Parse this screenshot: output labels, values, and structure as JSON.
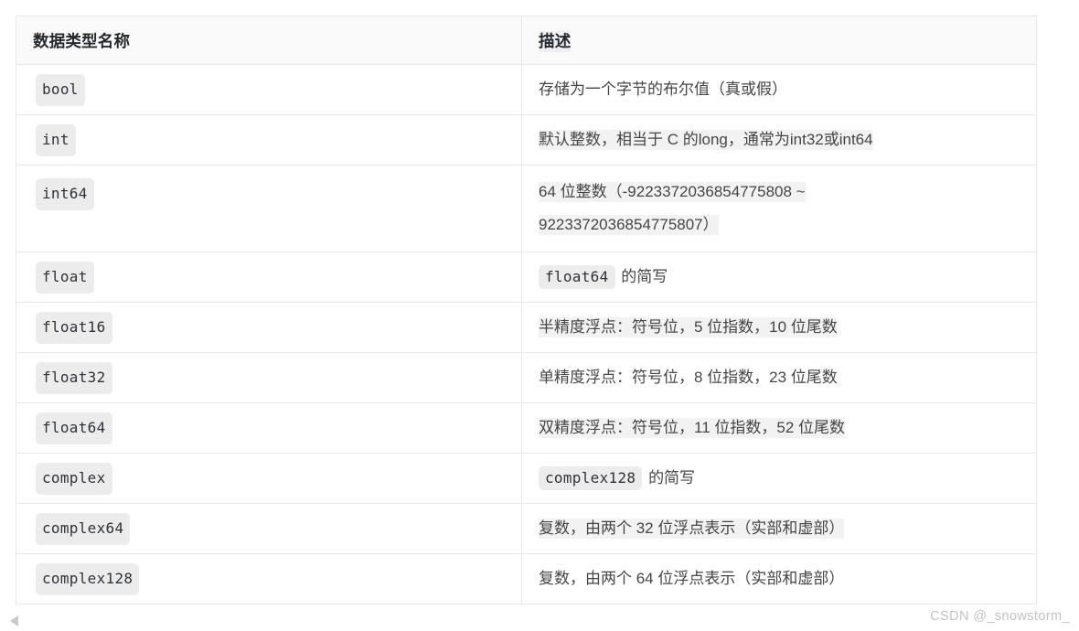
{
  "table": {
    "headers": {
      "name": "数据类型名称",
      "description": "描述"
    },
    "rows": [
      {
        "name": "bool",
        "desc_lines": [
          "存储为一个字节的布尔值（真或假）"
        ],
        "desc_prefix_code": "",
        "highlighted": false,
        "tall": false
      },
      {
        "name": "int",
        "desc_lines": [
          "默认整数，相当于 C 的long，通常为int32或int64"
        ],
        "desc_prefix_code": "",
        "highlighted": true,
        "tall": false
      },
      {
        "name": "int64",
        "desc_lines": [
          "64 位整数（-9223372036854775808 ~",
          "9223372036854775807）"
        ],
        "desc_prefix_code": "",
        "highlighted": true,
        "tall": true
      },
      {
        "name": "float",
        "desc_lines": [
          "的简写"
        ],
        "desc_prefix_code": "float64",
        "highlighted": false,
        "tall": false
      },
      {
        "name": "float16",
        "desc_lines": [
          "半精度浮点：符号位，5 位指数，10 位尾数"
        ],
        "desc_prefix_code": "",
        "highlighted": true,
        "tall": false
      },
      {
        "name": "float32",
        "desc_lines": [
          "单精度浮点：符号位，8 位指数，23 位尾数"
        ],
        "desc_prefix_code": "",
        "highlighted": false,
        "tall": false
      },
      {
        "name": "float64",
        "desc_lines": [
          "双精度浮点：符号位，11 位指数，52 位尾数"
        ],
        "desc_prefix_code": "",
        "highlighted": true,
        "tall": false
      },
      {
        "name": "complex",
        "desc_lines": [
          "的简写"
        ],
        "desc_prefix_code": "complex128",
        "highlighted": false,
        "tall": false
      },
      {
        "name": "complex64",
        "desc_lines": [
          "复数，由两个 32 位浮点表示（实部和虚部）"
        ],
        "desc_prefix_code": "",
        "highlighted": true,
        "tall": false
      },
      {
        "name": "complex128",
        "desc_lines": [
          "复数，由两个 64 位浮点表示（实部和虚部）"
        ],
        "desc_prefix_code": "",
        "highlighted": false,
        "tall": false
      }
    ]
  },
  "scrollbar": {
    "left_arrow_glyph": "◀"
  },
  "watermark": {
    "text": "CSDN @_snowstorm_"
  },
  "colors": {
    "header_bg": "#fafafa",
    "border": "#e8e8e8",
    "code_chip_bg": "#ececec",
    "selection_bg": "#f2f2f2",
    "text": "#454545",
    "watermark": "#c2c2c2"
  }
}
